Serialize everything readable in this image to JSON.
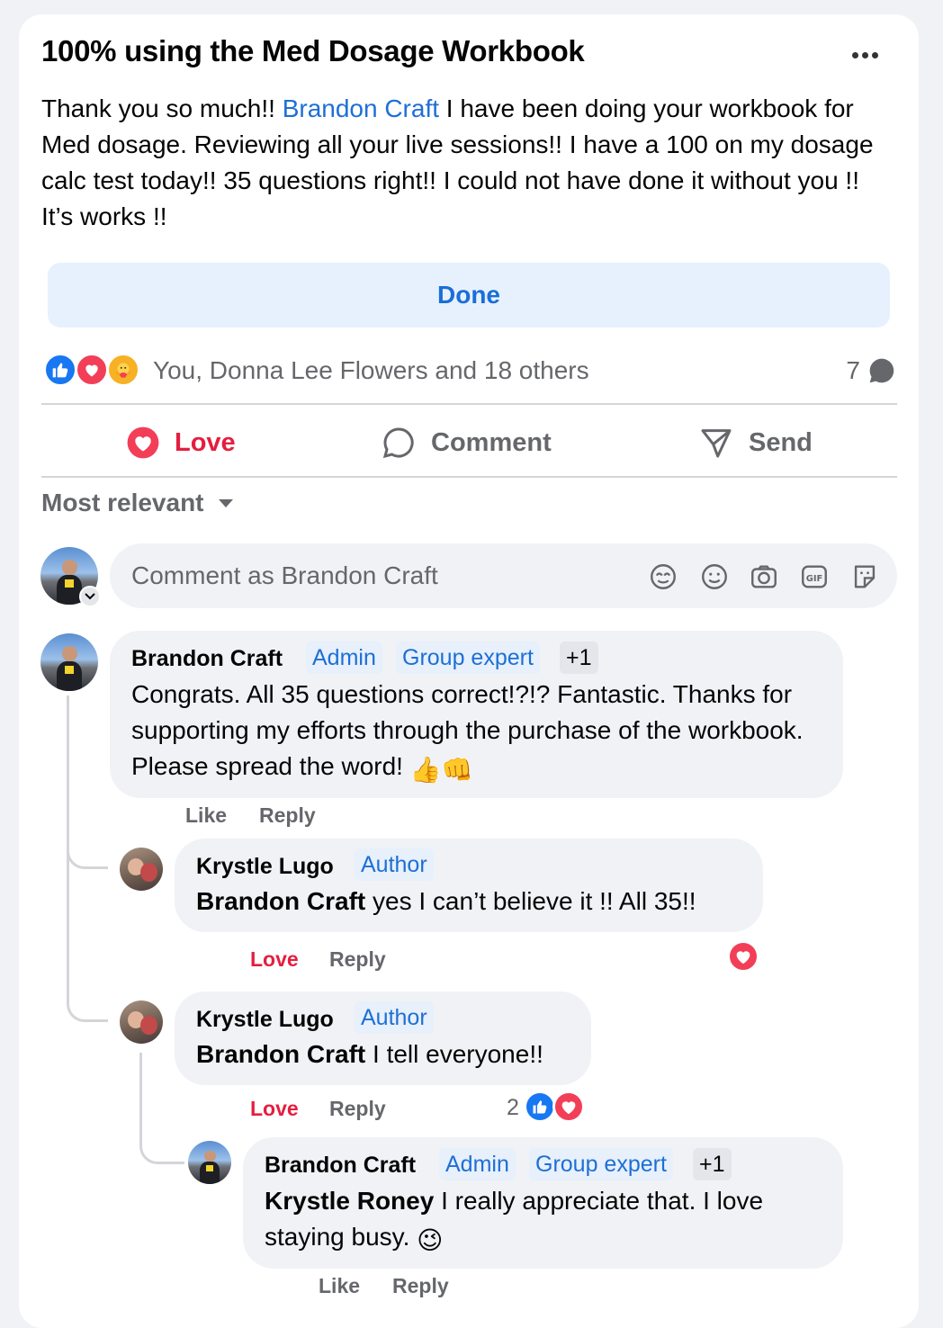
{
  "post": {
    "title": "100% using the Med Dosage Workbook",
    "body_before": "Thank you so much!! ",
    "mention": "Brandon Craft",
    "body_after": " I have been doing your workbook for Med dosage. Reviewing all your live sessions!! I have a 100 on my dosage calc test today!! 35 questions right!! I could not have done it without you !! It’s works !!",
    "done_label": "Done",
    "reactions": {
      "icons": [
        "like-icon",
        "love-icon",
        "care-icon"
      ],
      "summary": "You, Donna Lee Flowers and 18 others",
      "comment_count": "7"
    },
    "actions": {
      "love": "Love",
      "comment": "Comment",
      "send": "Send"
    }
  },
  "sort_label": "Most relevant",
  "composer": {
    "placeholder": "Comment as Brandon Craft"
  },
  "comments": [
    {
      "author": "Brandon Craft",
      "badges": [
        "Admin",
        "Group expert",
        "+1"
      ],
      "text": "Congrats. All 35 questions correct!?!? Fantastic. Thanks for supporting my efforts through the purchase of the workbook. Please spread the word! ",
      "emoji": "👍👊",
      "like": "Like",
      "reply": "Reply"
    },
    {
      "author": "Krystle Lugo",
      "badges": [
        "Author"
      ],
      "mention": "Brandon Craft",
      "text": " yes I can’t believe it !! All 35!!",
      "love": "Love",
      "reply": "Reply"
    },
    {
      "author": "Krystle Lugo",
      "badges": [
        "Author"
      ],
      "mention": "Brandon Craft",
      "text": " I tell everyone!!",
      "love": "Love",
      "reply": "Reply",
      "reaction_count": "2"
    },
    {
      "author": "Brandon Craft",
      "badges": [
        "Admin",
        "Group expert",
        "+1"
      ],
      "mention": "Krystle Roney",
      "text": " I really appreciate that. I love staying busy. ",
      "emoji": "😉",
      "like": "Like",
      "reply": "Reply"
    }
  ]
}
